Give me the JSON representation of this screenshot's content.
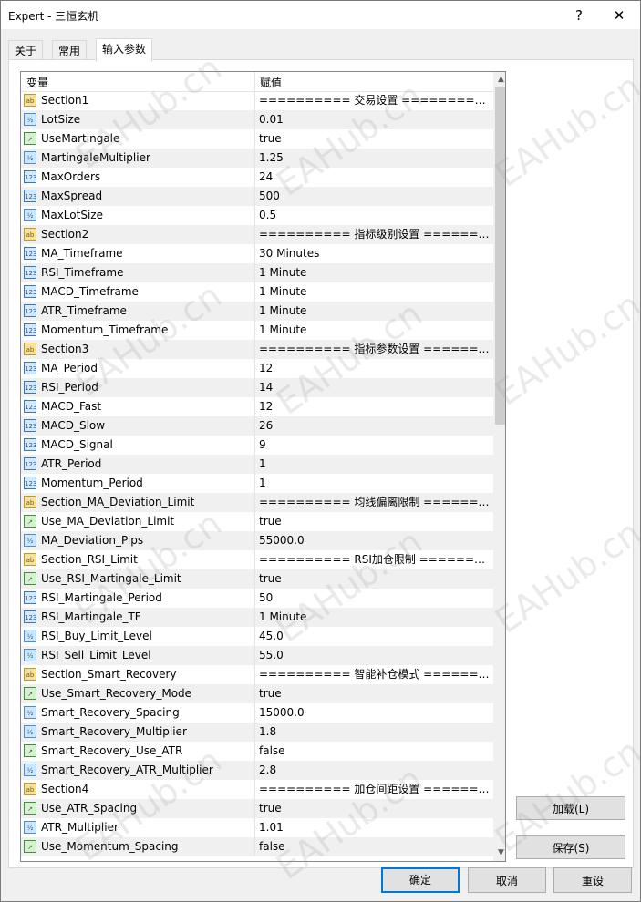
{
  "window": {
    "title": "Expert - 三恒玄机",
    "help": "?",
    "close": "✕"
  },
  "tabs": [
    {
      "label": "关于"
    },
    {
      "label": "常用"
    },
    {
      "label": "输入参数"
    }
  ],
  "grid": {
    "col_variable": "变量",
    "col_value": "赋值",
    "rows": [
      {
        "icon": "ab",
        "name": "Section1",
        "value": "========== 交易设置 =========="
      },
      {
        "icon": "dbl",
        "name": "LotSize",
        "value": "0.01"
      },
      {
        "icon": "bool",
        "name": "UseMartingale",
        "value": "true"
      },
      {
        "icon": "dbl",
        "name": "MartingaleMultiplier",
        "value": "1.25"
      },
      {
        "icon": "int",
        "name": "MaxOrders",
        "value": "24"
      },
      {
        "icon": "int",
        "name": "MaxSpread",
        "value": "500"
      },
      {
        "icon": "dbl",
        "name": "MaxLotSize",
        "value": "0.5"
      },
      {
        "icon": "ab",
        "name": "Section2",
        "value": "========== 指标级别设置 =======..."
      },
      {
        "icon": "int",
        "name": "MA_Timeframe",
        "value": "30 Minutes"
      },
      {
        "icon": "int",
        "name": "RSI_Timeframe",
        "value": "1 Minute"
      },
      {
        "icon": "int",
        "name": "MACD_Timeframe",
        "value": "1 Minute"
      },
      {
        "icon": "int",
        "name": "ATR_Timeframe",
        "value": "1 Minute"
      },
      {
        "icon": "int",
        "name": "Momentum_Timeframe",
        "value": "1 Minute"
      },
      {
        "icon": "ab",
        "name": "Section3",
        "value": "========== 指标参数设置 =======..."
      },
      {
        "icon": "int",
        "name": "MA_Period",
        "value": "12"
      },
      {
        "icon": "int",
        "name": "RSI_Period",
        "value": "14"
      },
      {
        "icon": "int",
        "name": "MACD_Fast",
        "value": "12"
      },
      {
        "icon": "int",
        "name": "MACD_Slow",
        "value": "26"
      },
      {
        "icon": "int",
        "name": "MACD_Signal",
        "value": "9"
      },
      {
        "icon": "int",
        "name": "ATR_Period",
        "value": "1"
      },
      {
        "icon": "int",
        "name": "Momentum_Period",
        "value": "1"
      },
      {
        "icon": "ab",
        "name": "Section_MA_Deviation_Limit",
        "value": "========== 均线偏离限制 =======..."
      },
      {
        "icon": "bool",
        "name": "Use_MA_Deviation_Limit",
        "value": "true"
      },
      {
        "icon": "dbl",
        "name": "MA_Deviation_Pips",
        "value": "55000.0"
      },
      {
        "icon": "ab",
        "name": "Section_RSI_Limit",
        "value": "========== RSI加仓限制 =======..."
      },
      {
        "icon": "bool",
        "name": "Use_RSI_Martingale_Limit",
        "value": "true"
      },
      {
        "icon": "int",
        "name": "RSI_Martingale_Period",
        "value": "50"
      },
      {
        "icon": "int",
        "name": "RSI_Martingale_TF",
        "value": "1 Minute"
      },
      {
        "icon": "dbl",
        "name": "RSI_Buy_Limit_Level",
        "value": "45.0"
      },
      {
        "icon": "dbl",
        "name": "RSI_Sell_Limit_Level",
        "value": "55.0"
      },
      {
        "icon": "ab",
        "name": "Section_Smart_Recovery",
        "value": "========== 智能补仓模式 =======..."
      },
      {
        "icon": "bool",
        "name": "Use_Smart_Recovery_Mode",
        "value": "true"
      },
      {
        "icon": "dbl",
        "name": "Smart_Recovery_Spacing",
        "value": "15000.0"
      },
      {
        "icon": "dbl",
        "name": "Smart_Recovery_Multiplier",
        "value": "1.8"
      },
      {
        "icon": "bool",
        "name": "Smart_Recovery_Use_ATR",
        "value": "false"
      },
      {
        "icon": "dbl",
        "name": "Smart_Recovery_ATR_Multiplier",
        "value": "2.8"
      },
      {
        "icon": "ab",
        "name": "Section4",
        "value": "========== 加仓间距设置 =======..."
      },
      {
        "icon": "bool",
        "name": "Use_ATR_Spacing",
        "value": "true"
      },
      {
        "icon": "dbl",
        "name": "ATR_Multiplier",
        "value": "1.01"
      },
      {
        "icon": "bool",
        "name": "Use_Momentum_Spacing",
        "value": "false"
      }
    ]
  },
  "icon_labels": {
    "ab": "ab",
    "dbl": "½",
    "int": "123",
    "bool": "↗"
  },
  "side_buttons": {
    "load": "加载(L)",
    "save": "保存(S)"
  },
  "bottom_buttons": {
    "ok": "确定",
    "cancel": "取消",
    "reset": "重设"
  },
  "watermark": "EAHub.cn"
}
